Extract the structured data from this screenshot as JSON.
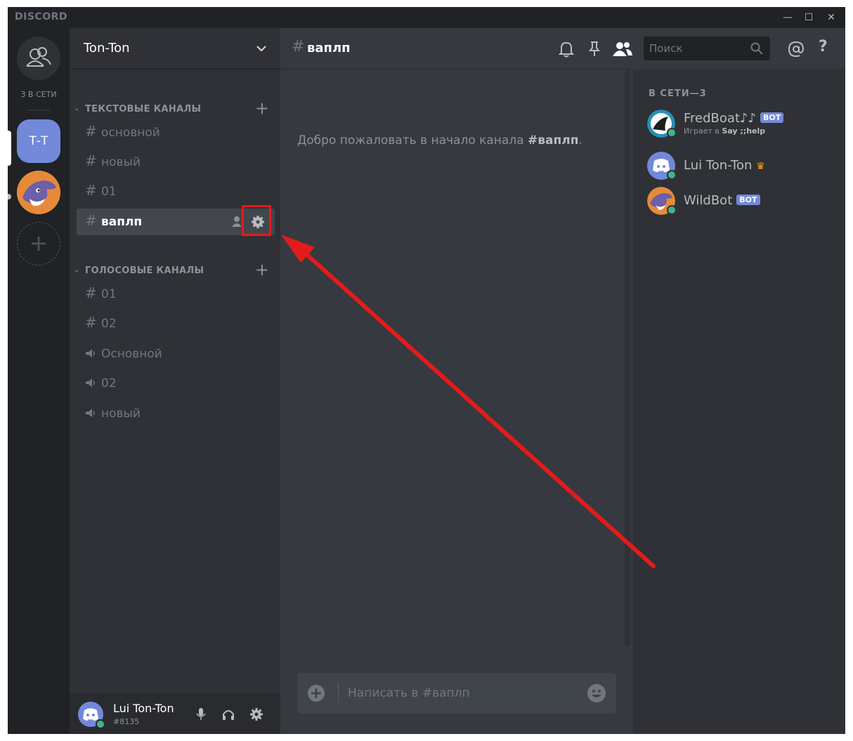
{
  "app": {
    "brand": "DISCORD"
  },
  "window_controls": {
    "minimize": "—",
    "maximize": "☐",
    "close": "✕"
  },
  "rail": {
    "online_count": "3 В СЕТИ",
    "servers": [
      {
        "abbr": "Т-Т",
        "color": "#7289da"
      }
    ],
    "add_server": "+"
  },
  "sidebar": {
    "server_name": "Ton-Ton",
    "text_category": "ТЕКСТОВЫЕ КАНАЛЫ",
    "voice_category": "ГОЛОСОВЫЕ КАНАЛЫ",
    "text_channels": [
      "основной",
      "новый",
      "01",
      "ваплп"
    ],
    "voice_channels": [
      {
        "type": "text",
        "name": "01"
      },
      {
        "type": "text",
        "name": "02"
      },
      {
        "type": "voice",
        "name": "Основной"
      },
      {
        "type": "voice",
        "name": "02"
      },
      {
        "type": "voice",
        "name": "новый"
      }
    ],
    "active_channel": "ваплп"
  },
  "user": {
    "name": "Lui Ton-Ton",
    "tag": "#8135"
  },
  "chat": {
    "channel_name": "ваплп",
    "search_placeholder": "Поиск",
    "welcome_prefix": "Добро пожаловать в начало канала ",
    "welcome_channel": "#ваплп",
    "welcome_suffix": ".",
    "composer_placeholder": "Написать в #ваплп"
  },
  "members": {
    "title": "В СЕТИ—3",
    "list": [
      {
        "name": "FredBoat♪♪",
        "bot": "BOT",
        "sub_prefix": "Играет в ",
        "sub_game": "Say ;;help"
      },
      {
        "name": "Lui Ton-Ton",
        "crown": "♛"
      },
      {
        "name": "WildBot",
        "bot": "BOT"
      }
    ]
  },
  "colors": {
    "accent": "#7289da",
    "online": "#43b581",
    "annotation": "#e31b1b",
    "crown": "#faa61a"
  }
}
